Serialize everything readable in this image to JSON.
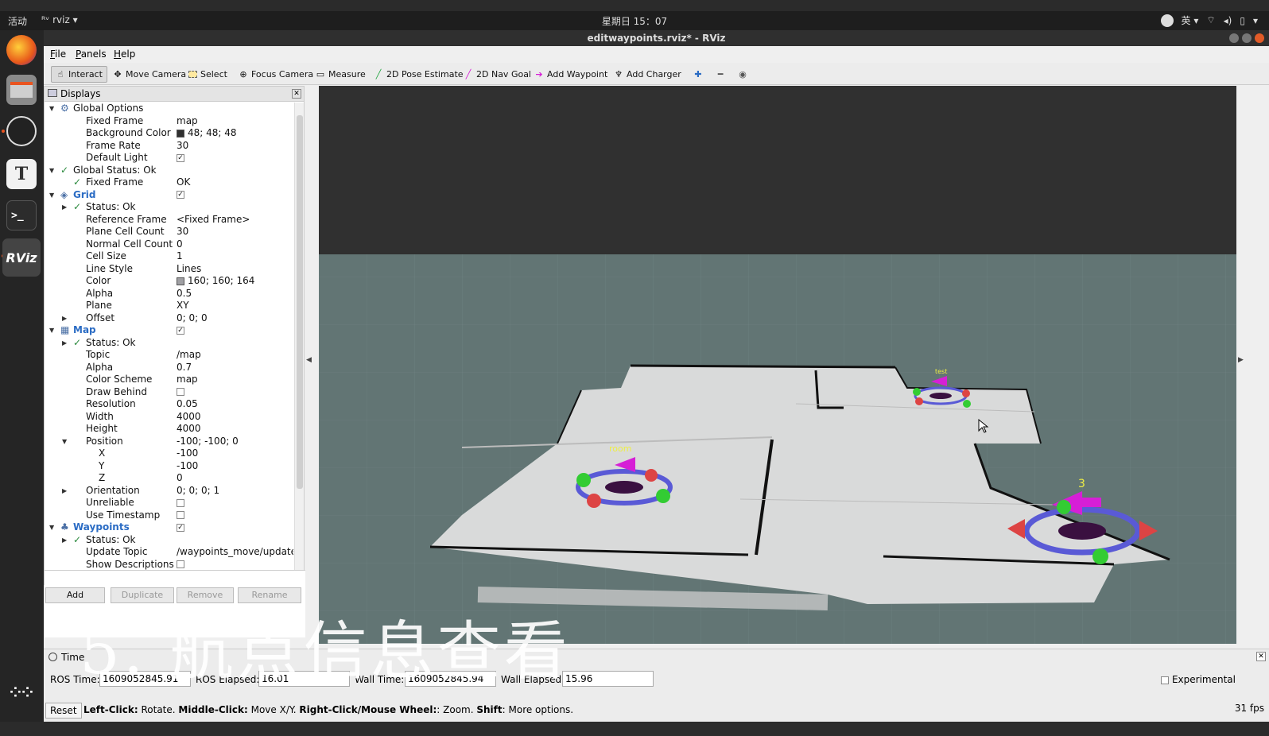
{
  "system": {
    "activities": "活动",
    "app_name": "rviz",
    "clock": "星期日 15：07",
    "input_method": "英"
  },
  "window": {
    "title": "editwaypoints.rviz* - RViz"
  },
  "menu": [
    "File",
    "Panels",
    "Help"
  ],
  "toolbar": {
    "interact": "Interact",
    "move_camera": "Move Camera",
    "select": "Select",
    "focus_camera": "Focus Camera",
    "measure": "Measure",
    "pose_estimate": "2D Pose Estimate",
    "nav_goal": "2D Nav Goal",
    "add_waypoint": "Add Waypoint",
    "add_charger": "Add Charger"
  },
  "displays": {
    "title": "Displays",
    "rows": [
      {
        "k": "Global Options",
        "v": "",
        "lvl": 0,
        "tri": "down",
        "icon": "gear-icon"
      },
      {
        "k": "Fixed Frame",
        "v": "map",
        "lvl": 1
      },
      {
        "k": "Background Color",
        "v": "48; 48; 48",
        "lvl": 1,
        "swatch": "#303030"
      },
      {
        "k": "Frame Rate",
        "v": "30",
        "lvl": 1
      },
      {
        "k": "Default Light",
        "v": "",
        "lvl": 1,
        "cb": true
      },
      {
        "k": "Global Status: Ok",
        "v": "",
        "lvl": 0,
        "tri": "down",
        "check": true
      },
      {
        "k": "Fixed Frame",
        "v": "OK",
        "lvl": 1,
        "check": true
      },
      {
        "k": "Grid",
        "v": "",
        "lvl": 0,
        "tri": "down",
        "blue": true,
        "cb": true,
        "icon": "grid-icon"
      },
      {
        "k": "Status: Ok",
        "v": "",
        "lvl": 1,
        "tri": "right",
        "check": true
      },
      {
        "k": "Reference Frame",
        "v": "<Fixed Frame>",
        "lvl": 1
      },
      {
        "k": "Plane Cell Count",
        "v": "30",
        "lvl": 1
      },
      {
        "k": "Normal Cell Count",
        "v": "0",
        "lvl": 1
      },
      {
        "k": "Cell Size",
        "v": "1",
        "lvl": 1
      },
      {
        "k": "Line Style",
        "v": "Lines",
        "lvl": 1
      },
      {
        "k": "Color",
        "v": "160; 160; 164",
        "lvl": 1,
        "swatch": "#a0a0a4"
      },
      {
        "k": "Alpha",
        "v": "0.5",
        "lvl": 1
      },
      {
        "k": "Plane",
        "v": "XY",
        "lvl": 1
      },
      {
        "k": "Offset",
        "v": "0; 0; 0",
        "lvl": 1,
        "tri": "right"
      },
      {
        "k": "Map",
        "v": "",
        "lvl": 0,
        "tri": "down",
        "blue": true,
        "cb": true,
        "icon": "map-icon"
      },
      {
        "k": "Status: Ok",
        "v": "",
        "lvl": 1,
        "tri": "right",
        "check": true
      },
      {
        "k": "Topic",
        "v": "/map",
        "lvl": 1
      },
      {
        "k": "Alpha",
        "v": "0.7",
        "lvl": 1
      },
      {
        "k": "Color Scheme",
        "v": "map",
        "lvl": 1
      },
      {
        "k": "Draw Behind",
        "v": "",
        "lvl": 1,
        "cb": false
      },
      {
        "k": "Resolution",
        "v": "0.05",
        "lvl": 1
      },
      {
        "k": "Width",
        "v": "4000",
        "lvl": 1
      },
      {
        "k": "Height",
        "v": "4000",
        "lvl": 1
      },
      {
        "k": "Position",
        "v": "-100; -100; 0",
        "lvl": 1,
        "tri": "down"
      },
      {
        "k": "X",
        "v": "-100",
        "lvl": 2
      },
      {
        "k": "Y",
        "v": "-100",
        "lvl": 2
      },
      {
        "k": "Z",
        "v": "0",
        "lvl": 2
      },
      {
        "k": "Orientation",
        "v": "0; 0; 0; 1",
        "lvl": 1,
        "tri": "right"
      },
      {
        "k": "Unreliable",
        "v": "",
        "lvl": 1,
        "cb": false
      },
      {
        "k": "Use Timestamp",
        "v": "",
        "lvl": 1,
        "cb": false
      },
      {
        "k": "Waypoints",
        "v": "",
        "lvl": 0,
        "tri": "down",
        "blue": true,
        "cb": true,
        "icon": "waypoints-icon"
      },
      {
        "k": "Status: Ok",
        "v": "",
        "lvl": 1,
        "tri": "right",
        "check": true
      },
      {
        "k": "Update Topic",
        "v": "/waypoints_move/update",
        "lvl": 1
      },
      {
        "k": "Show Descriptions",
        "v": "",
        "lvl": 1,
        "cb": false
      }
    ]
  },
  "panel_buttons": {
    "add": "Add",
    "duplicate": "Duplicate",
    "remove": "Remove",
    "rename": "Rename"
  },
  "scene": {
    "labels": {
      "test": "test",
      "room": "room",
      "three": "3"
    }
  },
  "time": {
    "title": "Time",
    "ros_time_label": "ROS Time:",
    "ros_time": "1609052845.91",
    "ros_elapsed_label": "ROS Elapsed:",
    "ros_elapsed": "16.01",
    "wall_time_label": "Wall Time:",
    "wall_time": "1609052845.94",
    "wall_elapsed_label": "Wall Elapsed:",
    "wall_elapsed": "15.96",
    "experimental": "Experimental"
  },
  "status": {
    "reset": "Reset",
    "left_click": "Left-Click:",
    "left_click_desc": " Rotate. ",
    "middle_click": "Middle-Click:",
    "middle_click_desc": " Move X/Y. ",
    "right_click": "Right-Click/Mouse Wheel:",
    "right_click_desc": ": Zoom. ",
    "shift": "Shift",
    "shift_desc": ": More options.",
    "fps": "31 fps"
  },
  "subtitle": "5. 航点信息查看"
}
